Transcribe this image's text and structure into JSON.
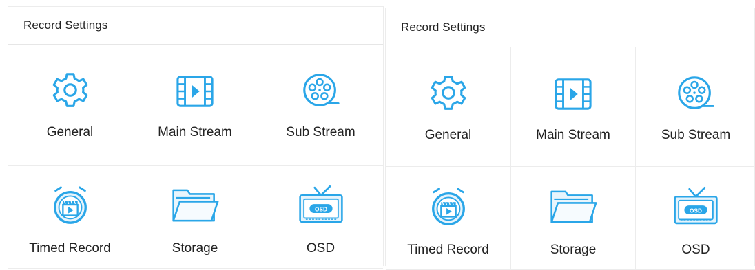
{
  "panels": [
    {
      "title": "Record Settings",
      "tiles": [
        {
          "label": "General",
          "icon": "gear-icon"
        },
        {
          "label": "Main Stream",
          "icon": "film-icon"
        },
        {
          "label": "Sub Stream",
          "icon": "film-reel-icon"
        },
        {
          "label": "Timed Record",
          "icon": "alarm-clock-icon"
        },
        {
          "label": "Storage",
          "icon": "folder-icon"
        },
        {
          "label": "OSD",
          "icon": "tv-icon"
        }
      ]
    },
    {
      "title": "Record Settings",
      "tiles": [
        {
          "label": "General",
          "icon": "gear-icon"
        },
        {
          "label": "Main Stream",
          "icon": "film-icon"
        },
        {
          "label": "Sub Stream",
          "icon": "film-reel-icon"
        },
        {
          "label": "Timed Record",
          "icon": "alarm-clock-icon"
        },
        {
          "label": "Storage",
          "icon": "folder-icon"
        },
        {
          "label": "OSD",
          "icon": "tv-icon"
        }
      ]
    }
  ],
  "colors": {
    "icon_blue": "#2aa6e8",
    "icon_fill_light": "#d8eefb",
    "border": "#ececec",
    "text": "#222222"
  },
  "osd_badge_text": "OSD"
}
